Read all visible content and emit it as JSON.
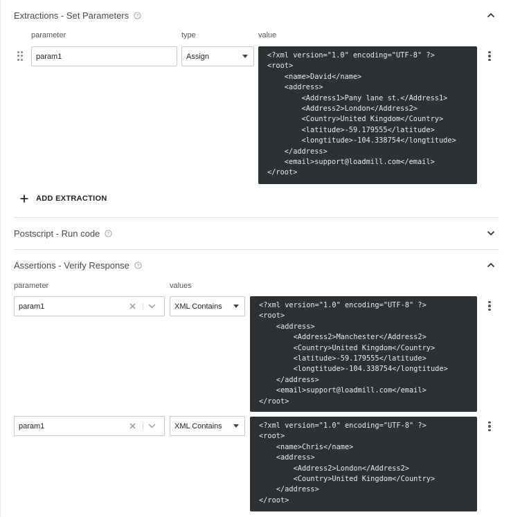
{
  "extractions": {
    "title": "Extractions - Set Parameters",
    "columns": {
      "parameter": "parameter",
      "type": "type",
      "value": "value"
    },
    "row": {
      "parameter": "param1",
      "type": "Assign",
      "value": "<?xml version=\"1.0\" encoding=\"UTF-8\" ?>\n<root>\n    <name>David</name>\n    <address>\n        <Address1>Pany lane st.</Address1>\n        <Address2>London</Address2>\n        <Country>United Kingdom</Country>\n        <latitude>-59.179555</latitude>\n        <longtitude>-104.338754</longtitude>\n    </address>\n    <email>support@loadmill.com</email>\n</root>"
    },
    "add_label": "ADD EXTRACTION"
  },
  "postscript": {
    "title": "Postscript - Run code"
  },
  "assertions": {
    "title": "Assertions - Verify Response",
    "columns": {
      "parameter": "parameter",
      "values": "values"
    },
    "rows": [
      {
        "parameter": "param1",
        "type": "XML Contains",
        "value": "<?xml version=\"1.0\" encoding=\"UTF-8\" ?>\n<root>\n    <address>\n        <Address2>Manchester</Address2>\n        <Country>United Kingdom</Country>\n        <latitude>-59.179555</latitude>\n        <longtitude>-104.338754</longtitude>\n    </address>\n    <email>support@loadmill.com</email>\n</root>"
      },
      {
        "parameter": "param1",
        "type": "XML Contains",
        "value": "<?xml version=\"1.0\" encoding=\"UTF-8\" ?>\n<root>\n    <name>Chris</name>\n    <address>\n        <Address2>London</Address2>\n        <Country>United Kingdom</Country>\n    </address>\n</root>"
      }
    ]
  },
  "icons": {
    "help": "help-circle-icon",
    "collapse": "chevron-up-icon",
    "expand": "chevron-down-icon",
    "more": "more-vertical-icon",
    "drag": "drag-handle-icon",
    "add": "plus-icon",
    "clear": "close-icon"
  },
  "colors": {
    "code_background": "#2d3035",
    "code_text": "#eaeaea",
    "border": "#c8c8c8"
  }
}
